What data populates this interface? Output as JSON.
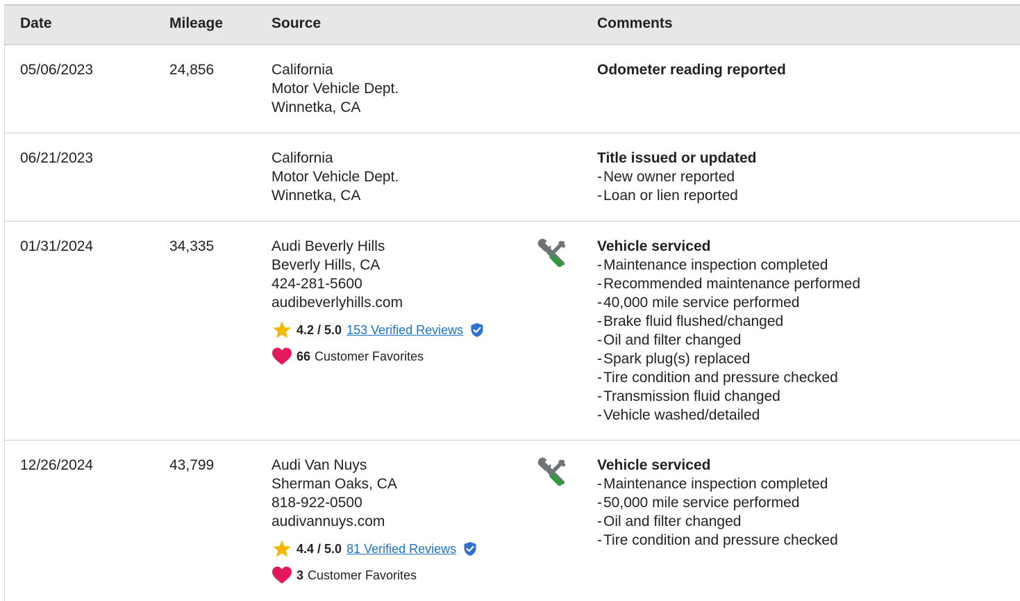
{
  "header": {
    "date": "Date",
    "mileage": "Mileage",
    "source": "Source",
    "comments": "Comments"
  },
  "rows": [
    {
      "date": "05/06/2023",
      "mileage": "24,856",
      "source": [
        "California",
        "Motor Vehicle Dept.",
        "Winnetka, CA"
      ],
      "comment_title": "Odometer reading reported",
      "comment_items": []
    },
    {
      "date": "06/21/2023",
      "mileage": "",
      "source": [
        "California",
        "Motor Vehicle Dept.",
        "Winnetka, CA"
      ],
      "comment_title": "Title issued or updated",
      "comment_items": [
        "New owner reported",
        "Loan or lien reported"
      ]
    },
    {
      "date": "01/31/2024",
      "mileage": "34,335",
      "source": [
        "Audi Beverly Hills",
        "Beverly Hills, CA",
        "424-281-5600",
        "audibeverlyhills.com"
      ],
      "rating": "4.2 / 5.0",
      "reviews": "153 Verified Reviews",
      "favorites_count": "66",
      "favorites_label": "Customer Favorites",
      "icon": "service-tools-icon",
      "comment_title": "Vehicle serviced",
      "comment_items": [
        "Maintenance inspection completed",
        "Recommended maintenance performed",
        "40,000 mile service performed",
        "Brake fluid flushed/changed",
        "Oil and filter changed",
        "Spark plug(s) replaced",
        "Tire condition and pressure checked",
        "Transmission fluid changed",
        "Vehicle washed/detailed"
      ]
    },
    {
      "date": "12/26/2024",
      "mileage": "43,799",
      "source": [
        "Audi Van Nuys",
        "Sherman Oaks, CA",
        "818-922-0500",
        "audivannuys.com"
      ],
      "rating": "4.4 / 5.0",
      "reviews": "81 Verified Reviews",
      "favorites_count": "3",
      "favorites_label": "Customer Favorites",
      "icon": "service-tools-icon",
      "comment_title": "Vehicle serviced",
      "comment_items": [
        "Maintenance inspection completed",
        "50,000 mile service performed",
        "Oil and filter changed",
        "Tire condition and pressure checked"
      ]
    }
  ],
  "colors": {
    "header_bg": "#e6e7e8",
    "link": "#1a73c8",
    "star": "#f5b800",
    "heart": "#e2195b",
    "verified": "#2f6fd0",
    "wrench_grey": "#6e7378",
    "screwdriver_green": "#2e9a3e"
  }
}
